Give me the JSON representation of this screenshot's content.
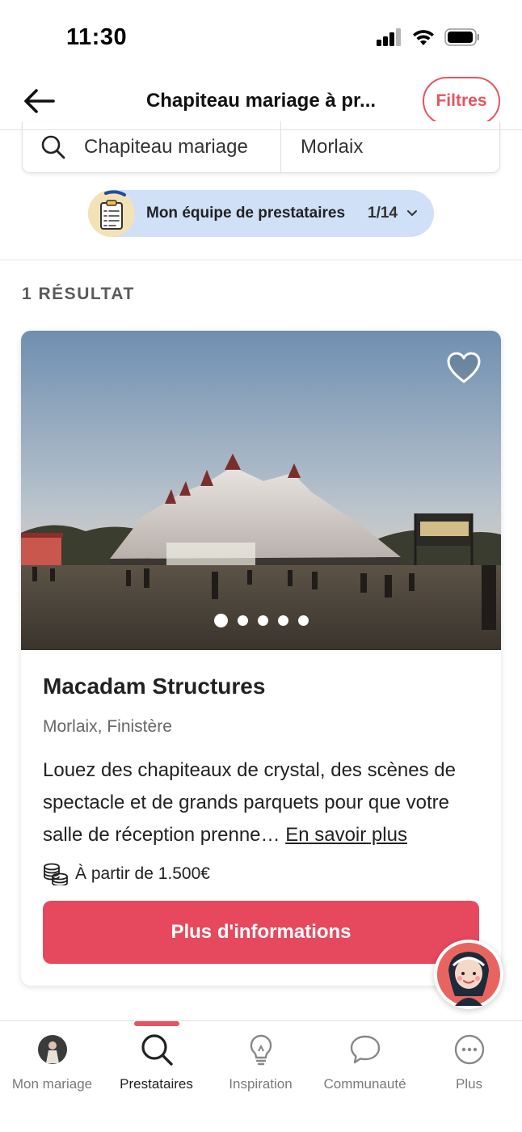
{
  "status_bar": {
    "time": "11:30"
  },
  "header": {
    "title": "Chapiteau mariage à pr...",
    "filter_label": "Filtres"
  },
  "search": {
    "query": "Chapiteau mariage",
    "location": "Morlaix"
  },
  "team": {
    "label": "Mon équipe de prestataires",
    "count": "1/14"
  },
  "results": {
    "count_label": "1 RÉSULTAT"
  },
  "card": {
    "title": "Macadam Structures",
    "location": "Morlaix, Finistère",
    "description": "Louez des chapiteaux de crystal, des scènes de spectacle et de grands parquets pour que votre salle de réception prenne…",
    "more_link": "En savoir plus",
    "price": "À partir de 1.500€",
    "cta": "Plus d'informations",
    "photo_count": 5,
    "active_photo": 1
  },
  "bottom_nav": {
    "items": [
      {
        "label": "Mon mariage"
      },
      {
        "label": "Prestataires"
      },
      {
        "label": "Inspiration"
      },
      {
        "label": "Communauté"
      },
      {
        "label": "Plus"
      }
    ],
    "active_index": 1
  },
  "colors": {
    "accent": "#e6545f",
    "cta": "#e6495e",
    "team_pill": "#cfe0f7"
  }
}
